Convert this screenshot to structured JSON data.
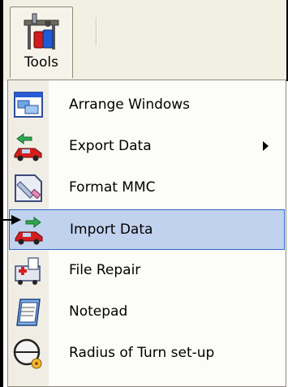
{
  "toolbar": {
    "tools_label": "Tools"
  },
  "menu": {
    "items": [
      {
        "label": "Arrange Windows",
        "icon": "arrange-windows-icon",
        "has_submenu": false,
        "selected": false
      },
      {
        "label": "Export Data",
        "icon": "export-data-icon",
        "has_submenu": true,
        "selected": false
      },
      {
        "label": "Format MMC",
        "icon": "format-mmc-icon",
        "has_submenu": false,
        "selected": false
      },
      {
        "label": "Import Data",
        "icon": "import-data-icon",
        "has_submenu": false,
        "selected": true
      },
      {
        "label": "File Repair",
        "icon": "file-repair-icon",
        "has_submenu": false,
        "selected": false
      },
      {
        "label": "Notepad",
        "icon": "notepad-icon",
        "has_submenu": false,
        "selected": false
      },
      {
        "label": "Radius of Turn set-up",
        "icon": "radius-of-turn-icon",
        "has_submenu": false,
        "selected": false
      }
    ]
  },
  "colors": {
    "selection_fill": "#c1d2ee",
    "selection_border": "#316ac5",
    "toolbar_bg": "#f2efe3",
    "menu_bg": "#fcfcf9"
  }
}
